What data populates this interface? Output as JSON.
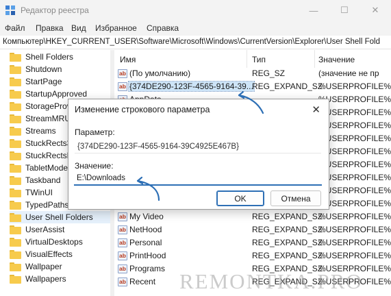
{
  "window": {
    "title": "Редактор реестра",
    "controls": {
      "minimize": "—",
      "maximize": "☐",
      "close": "✕"
    }
  },
  "menu": [
    "Файл",
    "Правка",
    "Вид",
    "Избранное",
    "Справка"
  ],
  "address": "Компьютер\\HKEY_CURRENT_USER\\Software\\Microsoft\\Windows\\CurrentVersion\\Explorer\\User Shell Fold",
  "tree": {
    "items": [
      {
        "label": "Shell Folders"
      },
      {
        "label": "Shutdown"
      },
      {
        "label": "StartPage"
      },
      {
        "label": "StartupApproved"
      },
      {
        "label": "StorageProv"
      },
      {
        "label": "StreamMRU"
      },
      {
        "label": "Streams"
      },
      {
        "label": "StuckRects3"
      },
      {
        "label": "StuckRectsL"
      },
      {
        "label": "TabletMode"
      },
      {
        "label": "Taskband"
      },
      {
        "label": "TWinUI"
      },
      {
        "label": "TypedPaths"
      },
      {
        "label": "User Shell Folders",
        "selected": true
      },
      {
        "label": "UserAssist"
      },
      {
        "label": "VirtualDesktops"
      },
      {
        "label": "VisualEffects"
      },
      {
        "label": "Wallpaper"
      },
      {
        "label": "Wallpapers"
      }
    ]
  },
  "list": {
    "columns": {
      "name": "Имя",
      "type": "Тип",
      "data": "Значение"
    },
    "rows": [
      {
        "name": "(По умолчанию)",
        "type": "REG_SZ",
        "data": "(значение не пр"
      },
      {
        "name": "{374DE290-123F-4565-9164-39...",
        "type": "REG_EXPAND_SZ",
        "data": "%USERPROFILE%",
        "highlighted": true
      },
      {
        "name": "AppData",
        "type": "",
        "data": "%USERPROFILE%"
      },
      {
        "name": "",
        "type": "",
        "data": "%USERPROFILE%"
      },
      {
        "name": "",
        "type": "",
        "data": "%USERPROFILE%"
      },
      {
        "name": "",
        "type": "",
        "data": "%USERPROFILE%"
      },
      {
        "name": "",
        "type": "",
        "data": "%USERPROFILE%"
      },
      {
        "name": "",
        "type": "",
        "data": "%USERPROFILE%"
      },
      {
        "name": "",
        "type": "",
        "data": "%USERPROFILE%"
      },
      {
        "name": "",
        "type": "",
        "data": "%USERPROFILE%"
      },
      {
        "name": "",
        "type": "",
        "data": "%USERPROFILE%"
      },
      {
        "name": "",
        "type": "",
        "data": "%USERPROFILE%"
      },
      {
        "name": "My Video",
        "type": "REG_EXPAND_SZ",
        "data": "%USERPROFILE%"
      },
      {
        "name": "NetHood",
        "type": "REG_EXPAND_SZ",
        "data": "%USERPROFILE%"
      },
      {
        "name": "Personal",
        "type": "REG_EXPAND_SZ",
        "data": "%USERPROFILE%"
      },
      {
        "name": "PrintHood",
        "type": "REG_EXPAND_SZ",
        "data": "%USERPROFILE%"
      },
      {
        "name": "Programs",
        "type": "REG_EXPAND_SZ",
        "data": "%USERPROFILE%"
      },
      {
        "name": "Recent",
        "type": "REG_EXPAND_SZ",
        "data": "%USERPROFILE%"
      }
    ]
  },
  "dialog": {
    "title": "Изменение строкового параметра",
    "close": "✕",
    "param_label": "Параметр:",
    "param_value": "{374DE290-123F-4565-9164-39C4925E467B}",
    "value_label": "Значение:",
    "value": "E:\\Downloads",
    "ok_label": "OK",
    "cancel_label": "Отмена"
  },
  "icons": {
    "app": "registry-editor-icon",
    "folder": "folder-icon",
    "string_value": "string-value-ab-icon",
    "ab_text": "ab"
  },
  "colors": {
    "accent": "#2d6fb5",
    "folder": "#f7cb4d",
    "selection": "#e5f0fb"
  },
  "watermark": "REMONTKA.PRO"
}
